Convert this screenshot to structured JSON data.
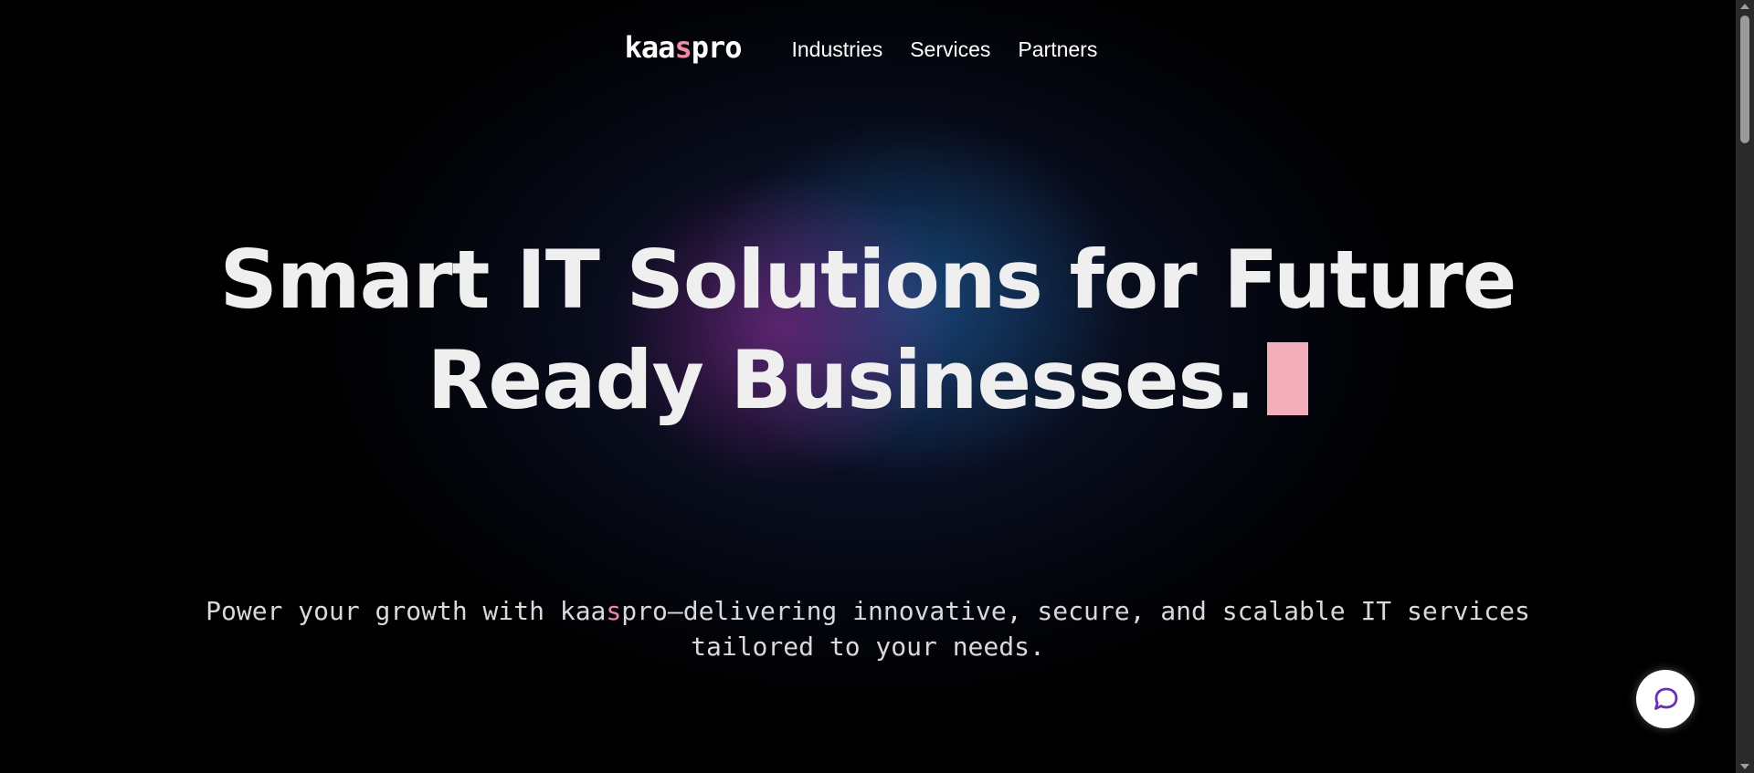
{
  "brand": {
    "logo_prefix": "kaa",
    "logo_accent": "s",
    "logo_suffix": "pro",
    "accent_color": "#f28aa3"
  },
  "nav": {
    "items": [
      {
        "label": "Industries"
      },
      {
        "label": "Services"
      },
      {
        "label": "Partners"
      }
    ]
  },
  "hero": {
    "headline_line1": "Smart IT Solutions for Future",
    "headline_line2": "Ready Businesses.",
    "subtitle_before": "Power your growth with kaa",
    "subtitle_accent": "s",
    "subtitle_after": "pro—delivering innovative, secure, and scalable IT services",
    "subtitle_line2": "tailored to your needs."
  },
  "chat": {
    "icon": "chat-bubble-icon"
  },
  "colors": {
    "background": "#000000",
    "cursor": "#f2aebb",
    "chat_icon": "#6b2fb3"
  }
}
